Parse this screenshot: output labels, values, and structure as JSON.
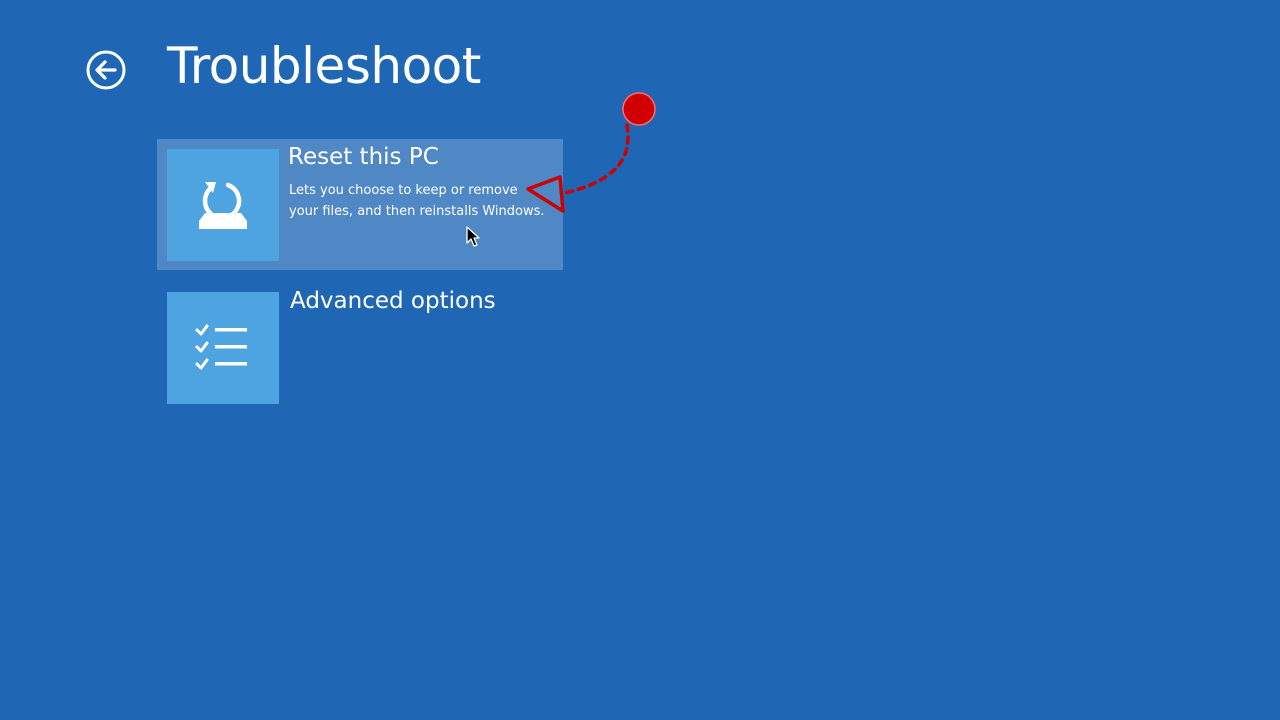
{
  "page": {
    "title": "Troubleshoot",
    "background_color": "#1f67b5"
  },
  "back_button": {
    "icon": "back-arrow-icon"
  },
  "options": [
    {
      "title": "Reset this PC",
      "description": "Lets you choose to keep or remove your files, and then reinstalls Windows.",
      "icon": "reset-pc-icon",
      "highlighted": true
    },
    {
      "title": "Advanced options",
      "description": "",
      "icon": "checklist-icon",
      "highlighted": false
    }
  ],
  "colors": {
    "tile": "#4ea3e1",
    "annotation": "#cc0000"
  }
}
